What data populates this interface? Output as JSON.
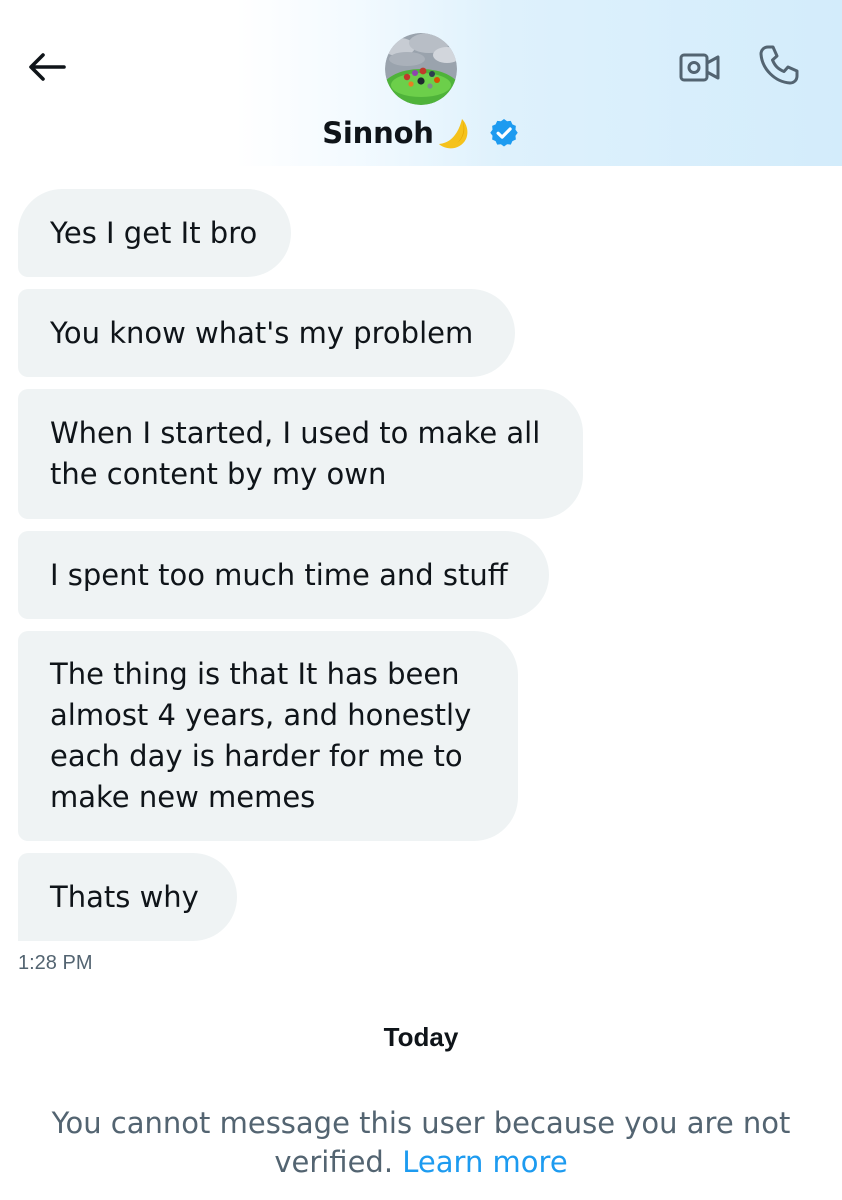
{
  "header": {
    "back_icon": "arrow-left-icon",
    "contact_name": "Sinnoh",
    "name_emoji": "crescent-moon",
    "verified_icon": "verified-badge-icon",
    "video_icon": "video-camera-icon",
    "call_icon": "phone-icon",
    "accent_color": "#1d9bf0"
  },
  "messages": [
    {
      "text": "Yes I get It bro"
    },
    {
      "text": "You know what's my problem"
    },
    {
      "text": "When I started, I used to make all\nthe content by my own"
    },
    {
      "text": "I spent too much time and stuff"
    },
    {
      "text": "The thing is that It has been\nalmost 4 years, and honestly\neach day is harder for me to\nmake new memes"
    },
    {
      "text": "Thats why"
    }
  ],
  "timestamp": "1:28 PM",
  "day_separator": "Today",
  "notice": {
    "text": "You cannot message this user because you are not verified. ",
    "link": "Learn more"
  }
}
